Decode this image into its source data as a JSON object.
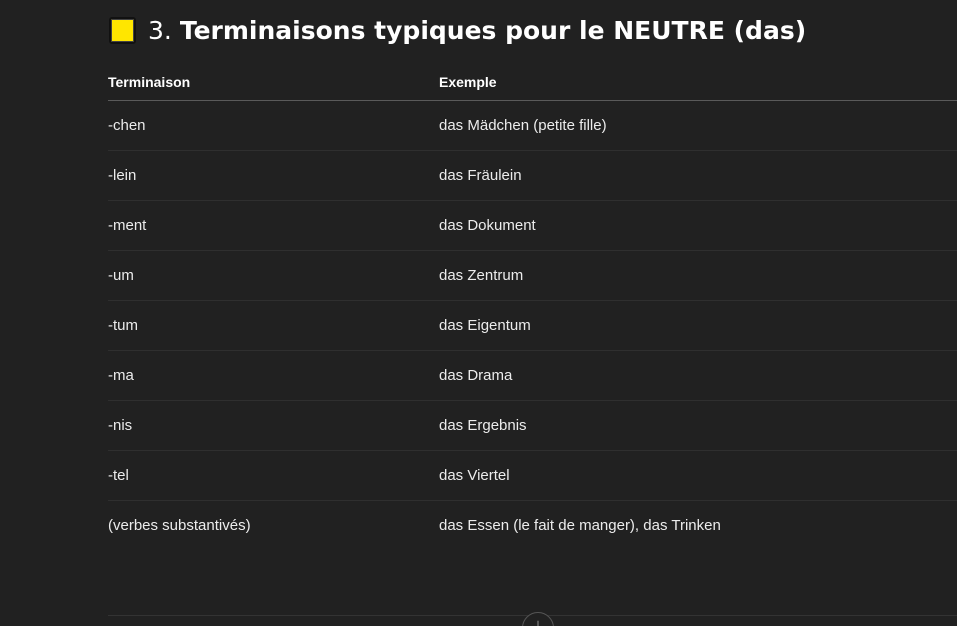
{
  "heading": {
    "icon": "yellow-square-icon",
    "icon_color": "#ffe600",
    "number": "3.",
    "title": "Terminaisons typiques pour le NEUTRE (das)"
  },
  "table": {
    "headers": [
      "Terminaison",
      "Exemple"
    ],
    "rows": [
      [
        "-chen",
        "das Mädchen (petite fille)"
      ],
      [
        "-lein",
        "das Fräulein"
      ],
      [
        "-ment",
        "das Dokument"
      ],
      [
        "-um",
        "das Zentrum"
      ],
      [
        "-tum",
        "das Eigentum"
      ],
      [
        "-ma",
        "das Drama"
      ],
      [
        "-nis",
        "das Ergebnis"
      ],
      [
        "-tel",
        "das Viertel"
      ],
      [
        "(verbes substantivés)",
        "das Essen (le fait de manger), das Trinken"
      ]
    ]
  },
  "scroll_button": {
    "icon": "arrow-down-icon",
    "glyph": "↓"
  },
  "colors": {
    "background": "#212121",
    "text": "#ececec",
    "accent": "#ffe600"
  }
}
